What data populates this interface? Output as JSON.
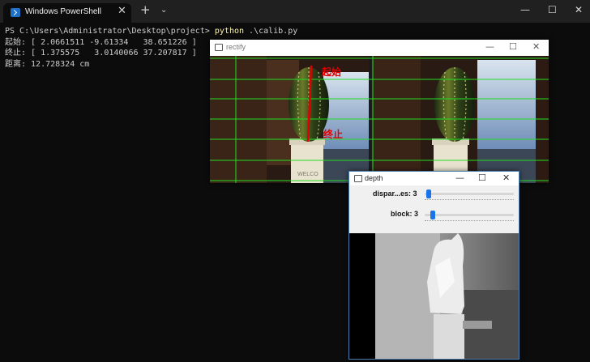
{
  "terminal": {
    "tab_title": "Windows PowerShell",
    "tab_close": "✕",
    "new_tab": "+",
    "tab_menu": "⌄",
    "minimize": "—",
    "maximize": "☐",
    "close": "✕",
    "prompt": "PS C:\\Users\\Administrator\\Desktop\\project> ",
    "command": "python",
    "command_arg": " .\\calib.py",
    "output_lines": [
      "起始: [ 2.0661511 -9.61334   38.651226 ]",
      "终止: [ 1.375575   3.0140066 37.207817 ]",
      "距离: 12.728324 cm"
    ]
  },
  "rectify_window": {
    "title": "rectify",
    "minimize": "—",
    "maximize": "☐",
    "close": "✕",
    "label_start": "起始",
    "label_end": "终止",
    "pot_text": "WELCO"
  },
  "depth_window": {
    "title": "depth",
    "minimize": "—",
    "maximize": "☐",
    "close": "✕",
    "sliders": [
      {
        "label": "dispar...es: 3",
        "value": 3
      },
      {
        "label": "block: 3",
        "value": 3
      }
    ]
  },
  "colors": {
    "terminal_bg": "#0c0c0c",
    "command": "#f9f1a5",
    "epipolar_lines": "#22dd22",
    "measure_line": "#e00000",
    "slider_thumb": "#1a73e8"
  }
}
